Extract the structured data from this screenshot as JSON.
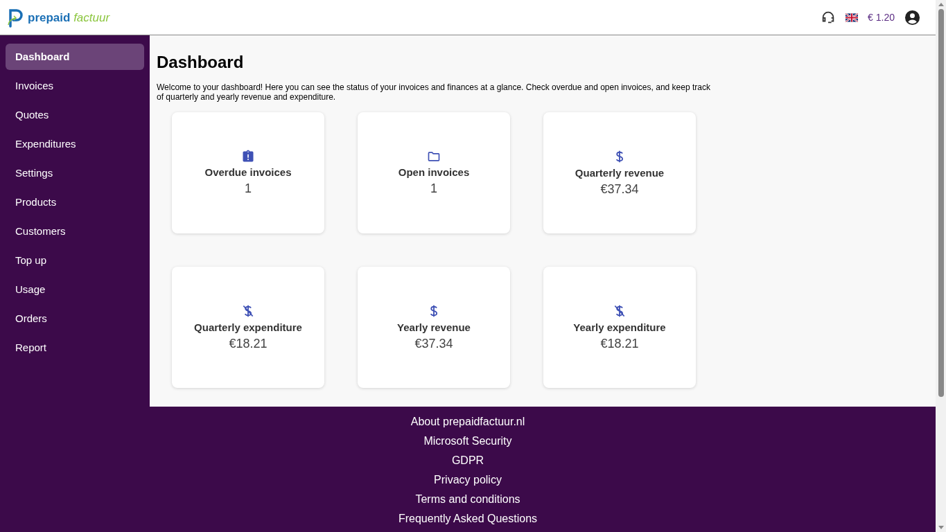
{
  "logo": {
    "primary": "prepaid",
    "secondary": "factuur"
  },
  "header": {
    "balance": "€ 1.20"
  },
  "sidebar": {
    "items": [
      {
        "label": "Dashboard",
        "selected": true
      },
      {
        "label": "Invoices",
        "selected": false
      },
      {
        "label": "Quotes",
        "selected": false
      },
      {
        "label": "Expenditures",
        "selected": false
      },
      {
        "label": "Settings",
        "selected": false
      },
      {
        "label": "Products",
        "selected": false
      },
      {
        "label": "Customers",
        "selected": false
      },
      {
        "label": "Top up",
        "selected": false
      },
      {
        "label": "Usage",
        "selected": false
      },
      {
        "label": "Orders",
        "selected": false
      },
      {
        "label": "Report",
        "selected": false
      }
    ]
  },
  "page": {
    "title": "Dashboard",
    "intro": "Welcome to your dashboard! Here you can see the status of your invoices and finances at a glance. Check overdue and open invoices, and keep track of quarterly and yearly revenue and expenditure."
  },
  "cards": [
    {
      "kind": "alert",
      "label": "Overdue invoices",
      "value": "1"
    },
    {
      "kind": "folder",
      "label": "Open invoices",
      "value": "1"
    },
    {
      "kind": "dollar",
      "label": "Quarterly revenue",
      "value": "€37.34"
    },
    {
      "kind": "dollar-off",
      "label": "Quarterly expenditure",
      "value": "€18.21"
    },
    {
      "kind": "dollar",
      "label": "Yearly revenue",
      "value": "€37.34"
    },
    {
      "kind": "dollar-off",
      "label": "Yearly expenditure",
      "value": "€18.21"
    }
  ],
  "footer": {
    "links": [
      "About prepaidfactuur.nl",
      "Microsoft Security",
      "GDPR",
      "Privacy policy",
      "Terms and conditions",
      "Frequently Asked Questions"
    ]
  }
}
